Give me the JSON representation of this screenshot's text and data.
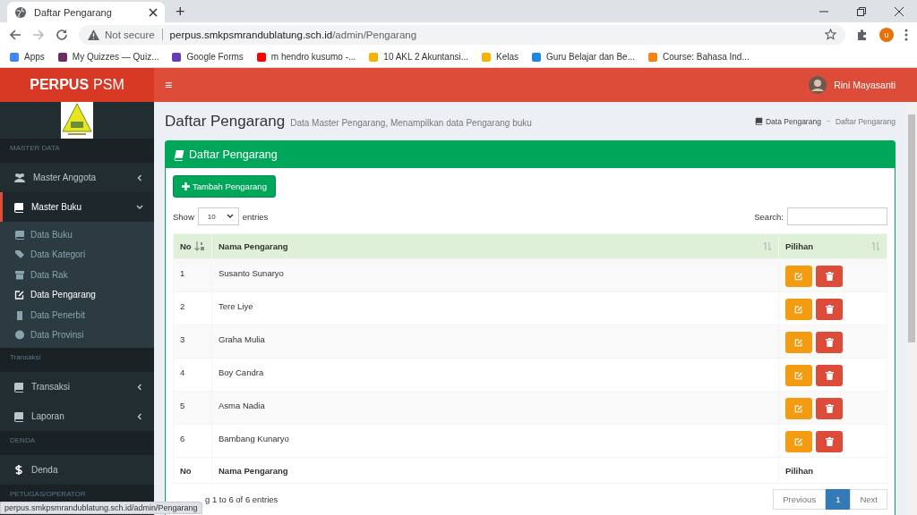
{
  "browser": {
    "tab_title": "Daftar Pengarang",
    "new_tab": "+",
    "security": "Not secure",
    "url_host": "perpus.smkpsmrandublatung.sch.id",
    "url_path": "/admin/Pengarang",
    "profile_initial": "u",
    "bookmarks": [
      {
        "label": "Apps",
        "color": "#4285f4"
      },
      {
        "label": "My Quizzes — Quiz...",
        "color": "#6d2b5e"
      },
      {
        "label": "Google Forms",
        "color": "#673ab7"
      },
      {
        "label": "m hendro kusumo -...",
        "color": "#ff0000"
      },
      {
        "label": "10 AKL 2 Akuntansi...",
        "color": "#f4b400"
      },
      {
        "label": "Kelas",
        "color": "#f4b400"
      },
      {
        "label": "Guru Belajar dan Be...",
        "color": "#1e88e5"
      },
      {
        "label": "Course: Bahasa Ind...",
        "color": "#f98012"
      }
    ]
  },
  "header": {
    "brand_bold": "PERPUS",
    "brand_rest": "PSM",
    "menu_toggle": "≡",
    "user_name": "Rini Mayasanti"
  },
  "sidebar": [
    {
      "kind": "header",
      "label": "MASTER DATA"
    },
    {
      "kind": "item",
      "label": "Master Anggota",
      "selected": false,
      "expanded": false
    },
    {
      "kind": "item",
      "label": "Master Buku",
      "selected": true,
      "expanded": true,
      "children": [
        {
          "label": "Data Buku",
          "selected": false
        },
        {
          "label": "Data Kategori",
          "selected": false
        },
        {
          "label": "Data Rak",
          "selected": false
        },
        {
          "label": "Data Pengarang",
          "selected": true
        },
        {
          "label": "Data Penerbit",
          "selected": false
        },
        {
          "label": "Data Provinsi",
          "selected": false
        }
      ]
    },
    {
      "kind": "header",
      "label": "Transaksi"
    },
    {
      "kind": "item",
      "label": "Transaksi",
      "selected": false,
      "expanded": false
    },
    {
      "kind": "item",
      "label": "Laporan",
      "selected": false,
      "expanded": false
    },
    {
      "kind": "header",
      "label": "DENDA"
    },
    {
      "kind": "item",
      "label": "Denda",
      "selected": false
    },
    {
      "kind": "header",
      "label": "PETUGAS/OPERATOR"
    }
  ],
  "page": {
    "title": "Daftar Pengarang",
    "subtitle": "Data Master Pengarang, Menampilkan data Pengarang buku",
    "breadcrumb": [
      "Data Pengarang",
      "Daftar Pengarang"
    ]
  },
  "box": {
    "title": "Daftar Pengarang",
    "add_button": "Tambah Pengarang",
    "show_label": "Show",
    "page_length": "10",
    "entries_label": "entries",
    "search_label": "Search:",
    "columns": [
      "No",
      "Nama Pengarang",
      "Pilihan"
    ],
    "rows": [
      {
        "no": "1",
        "name": "Susanto Sunaryo"
      },
      {
        "no": "2",
        "name": "Tere Liye"
      },
      {
        "no": "3",
        "name": "Graha Mulia"
      },
      {
        "no": "4",
        "name": "Boy Candra"
      },
      {
        "no": "5",
        "name": "Asma Nadia"
      },
      {
        "no": "6",
        "name": "Bambang Kunaryo"
      }
    ],
    "footer_columns": [
      "No",
      "Nama Pengarang",
      "Pilihan"
    ],
    "info": "g 1 to 6 of 6 entries",
    "pagination": [
      {
        "label": "Previous",
        "selected": false
      },
      {
        "label": "1",
        "selected": true
      },
      {
        "label": "Next",
        "selected": false
      }
    ]
  },
  "status_url": "perpus.smkpsmrandublatung.sch.id/admin/Pengarang"
}
